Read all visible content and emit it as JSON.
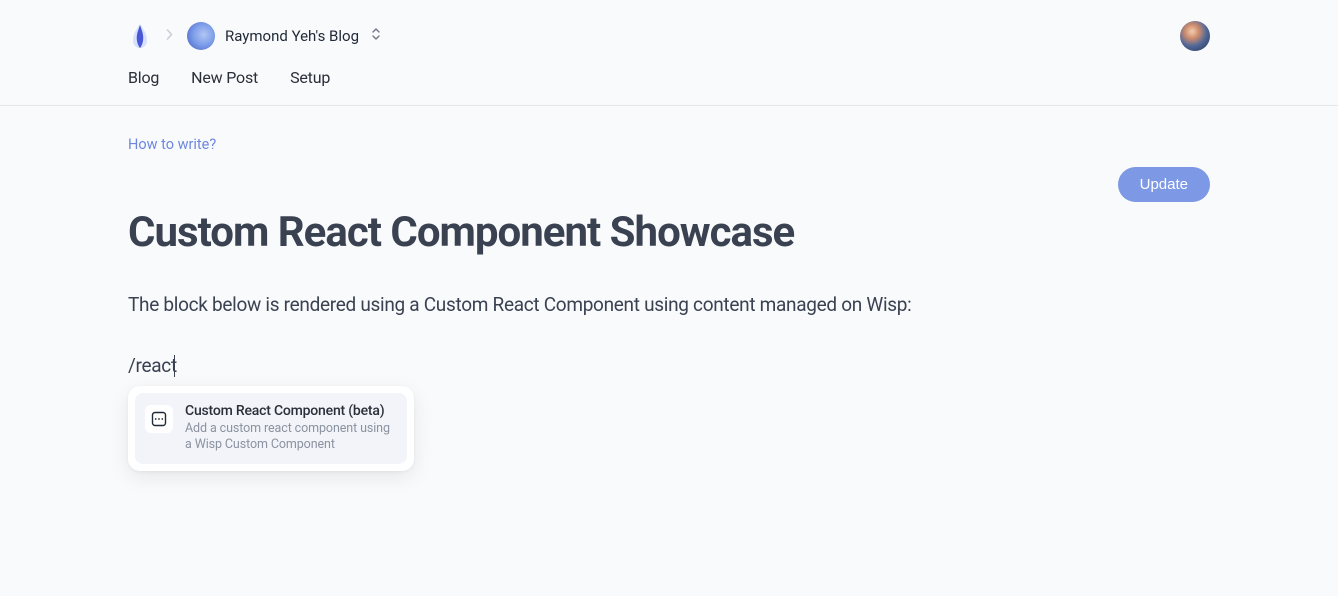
{
  "breadcrumb": {
    "site_title": "Raymond Yeh's Blog"
  },
  "tabs": {
    "blog": "Blog",
    "new_post": "New Post",
    "setup": "Setup"
  },
  "help_link": "How to write?",
  "update_label": "Update",
  "page_title": "Custom React Component Showcase",
  "body_text": "The block below is rendered using a Custom React Component using content managed on Wisp:",
  "slash_command": "/react",
  "popup": {
    "title": "Custom React Component (beta)",
    "desc": "Add a custom react component using a Wisp Custom Component"
  }
}
